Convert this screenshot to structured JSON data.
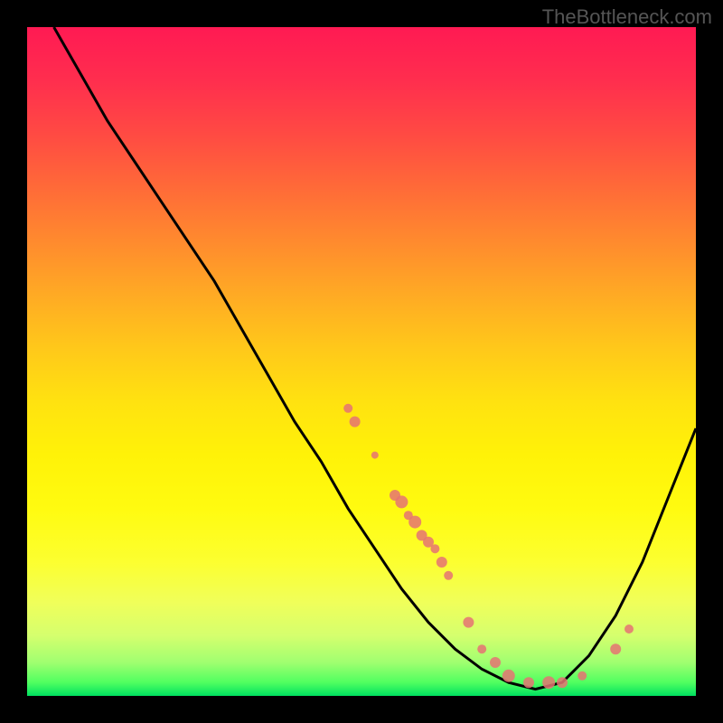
{
  "watermark": "TheBottleneck.com",
  "chart_data": {
    "type": "line",
    "title": "",
    "xlabel": "",
    "ylabel": "",
    "xlim": [
      0,
      100
    ],
    "ylim": [
      0,
      100
    ],
    "curve_points": [
      {
        "x": 4,
        "y": 100
      },
      {
        "x": 8,
        "y": 93
      },
      {
        "x": 12,
        "y": 86
      },
      {
        "x": 16,
        "y": 80
      },
      {
        "x": 20,
        "y": 74
      },
      {
        "x": 24,
        "y": 68
      },
      {
        "x": 28,
        "y": 62
      },
      {
        "x": 32,
        "y": 55
      },
      {
        "x": 36,
        "y": 48
      },
      {
        "x": 40,
        "y": 41
      },
      {
        "x": 44,
        "y": 35
      },
      {
        "x": 48,
        "y": 28
      },
      {
        "x": 52,
        "y": 22
      },
      {
        "x": 56,
        "y": 16
      },
      {
        "x": 60,
        "y": 11
      },
      {
        "x": 64,
        "y": 7
      },
      {
        "x": 68,
        "y": 4
      },
      {
        "x": 72,
        "y": 2
      },
      {
        "x": 76,
        "y": 1
      },
      {
        "x": 80,
        "y": 2
      },
      {
        "x": 84,
        "y": 6
      },
      {
        "x": 88,
        "y": 12
      },
      {
        "x": 92,
        "y": 20
      },
      {
        "x": 96,
        "y": 30
      },
      {
        "x": 100,
        "y": 40
      }
    ],
    "scatter_points": [
      {
        "x": 48,
        "y": 43,
        "r": 5
      },
      {
        "x": 49,
        "y": 41,
        "r": 6
      },
      {
        "x": 52,
        "y": 36,
        "r": 4
      },
      {
        "x": 55,
        "y": 30,
        "r": 6
      },
      {
        "x": 56,
        "y": 29,
        "r": 7
      },
      {
        "x": 57,
        "y": 27,
        "r": 5
      },
      {
        "x": 58,
        "y": 26,
        "r": 7
      },
      {
        "x": 59,
        "y": 24,
        "r": 6
      },
      {
        "x": 60,
        "y": 23,
        "r": 6
      },
      {
        "x": 61,
        "y": 22,
        "r": 5
      },
      {
        "x": 62,
        "y": 20,
        "r": 6
      },
      {
        "x": 63,
        "y": 18,
        "r": 5
      },
      {
        "x": 66,
        "y": 11,
        "r": 6
      },
      {
        "x": 68,
        "y": 7,
        "r": 5
      },
      {
        "x": 70,
        "y": 5,
        "r": 6
      },
      {
        "x": 72,
        "y": 3,
        "r": 7
      },
      {
        "x": 75,
        "y": 2,
        "r": 6
      },
      {
        "x": 78,
        "y": 2,
        "r": 7
      },
      {
        "x": 80,
        "y": 2,
        "r": 6
      },
      {
        "x": 83,
        "y": 3,
        "r": 5
      },
      {
        "x": 88,
        "y": 7,
        "r": 6
      },
      {
        "x": 90,
        "y": 10,
        "r": 5
      }
    ],
    "colors": {
      "curve": "#000000",
      "points": "#e57373",
      "gradient_top": "#ff1a53",
      "gradient_bottom": "#00e060"
    }
  }
}
